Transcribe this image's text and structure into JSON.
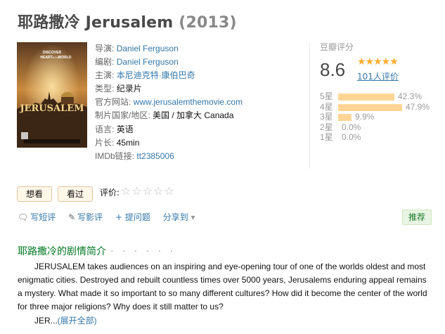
{
  "header": {
    "title": "耶路撒冷 Jerusalem",
    "year": "(2013)"
  },
  "poster": {
    "tagline_top": "DISCOVER",
    "tagline_mid": "HEART",
    "tagline_of": "of the",
    "tagline_world": "WORLD",
    "name": "JERUSALEM"
  },
  "info": {
    "director_label": "导演:",
    "director": "Daniel Ferguson",
    "writer_label": "编剧:",
    "writer": "Daniel Ferguson",
    "cast_label": "主演:",
    "cast": "本尼迪克特·康伯巴奇",
    "genre_label": "类型:",
    "genre": "纪录片",
    "site_label": "官方网站:",
    "site": "www.jerusalemthemovie.com",
    "country_label": "制片国家/地区:",
    "country": "美国 / 加拿大 Canada",
    "lang_label": "语言:",
    "lang": "英语",
    "runtime_label": "片长:",
    "runtime": "45min",
    "imdb_label": "IMDb链接:",
    "imdb": "tt2385006"
  },
  "rating": {
    "caption": "豆瓣评分",
    "score": "8.6",
    "stars": "★★★★★",
    "count": "101人评价",
    "star_value": 4.5,
    "bars": [
      {
        "label": "5星",
        "pct": "42.3%",
        "value": 42.3
      },
      {
        "label": "4星",
        "pct": "47.9%",
        "value": 47.9
      },
      {
        "label": "3星",
        "pct": "9.9%",
        "value": 9.9
      },
      {
        "label": "2星",
        "pct": "0.0%",
        "value": 0.0
      },
      {
        "label": "1星",
        "pct": "0.0%",
        "value": 0.0
      }
    ]
  },
  "buttons": {
    "want": "想看",
    "seen": "看过",
    "rate_label": "评价:",
    "empty_stars": "☆☆☆☆☆"
  },
  "actions": {
    "short_review": "写短评",
    "review": "写影评",
    "ask": "+ 提问题",
    "share": "分享到",
    "recommend": "推荐"
  },
  "summary": {
    "title": "耶路撒冷的剧情简介",
    "dots": "· · · · · ·",
    "text": "JERUSALEM takes audiences on an inspiring and eye-opening tour of one of the worlds oldest and most enigmatic cities. Destroyed and rebuilt countless times over 5000 years, Jerusalems enduring appeal remains a mystery. What made it so important to so many different cultures? How did it become the center of the world for three major religions? Why does it still matter to us?",
    "more_prefix": "JER...",
    "more_link": "(展开全部)"
  }
}
